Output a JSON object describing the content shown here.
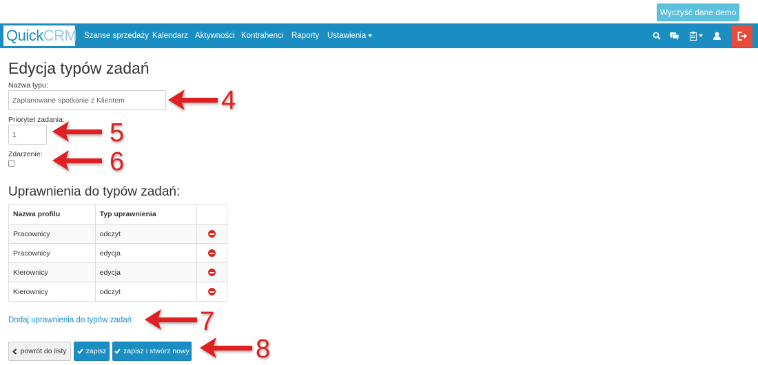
{
  "header": {
    "demo_button_label": "Wyczyść dane demo",
    "logo_quick": "Quick",
    "logo_crm": "CRM"
  },
  "nav": {
    "items": [
      {
        "label": "Szanse sprzedaży"
      },
      {
        "label": "Kalendarz"
      },
      {
        "label": "Aktywności"
      },
      {
        "label": "Kontrahenci"
      },
      {
        "label": "Raporty"
      },
      {
        "label": "Ustawienia"
      }
    ],
    "icons": [
      "search-icon",
      "comments-icon",
      "clipboard-icon",
      "user-icon",
      "logout-icon"
    ]
  },
  "form": {
    "title": "Edycja typów zadań",
    "type_name_label": "Nazwa typu:",
    "type_name_value": "Zaplanowane spotkanie z Klientem",
    "priority_label": "Priorytet zadania:",
    "priority_value": "1",
    "event_label": "Zdarzenie:",
    "event_checked": false
  },
  "permissions": {
    "title": "Uprawnienia do typów zadań:",
    "columns": [
      "Nazwa profilu",
      "Typ uprawnienia",
      ""
    ],
    "rows": [
      {
        "profile": "Pracownicy",
        "type": "odczyt"
      },
      {
        "profile": "Pracownicy",
        "type": "edycja"
      },
      {
        "profile": "Kierownicy",
        "type": "edycja"
      },
      {
        "profile": "Kierownicy",
        "type": "odczyt"
      }
    ],
    "add_link": "Dodaj uprawnienia do typów zadań"
  },
  "actions": {
    "back_label": "powrót do listy",
    "save_label": "zapisz",
    "save_new_label": "zapisz i stwórz nowy"
  },
  "annotations": {
    "numbers": [
      "4",
      "5",
      "6",
      "7",
      "8"
    ],
    "arrow_color": "#e02020"
  },
  "colors": {
    "brand": "#1a8ec2",
    "demo_button": "#5bc0de",
    "logout": "#e74c3c",
    "remove": "#d9241b"
  }
}
